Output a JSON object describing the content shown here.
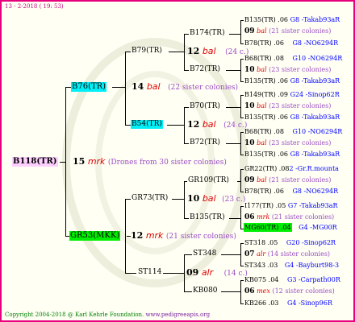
{
  "header": {
    "date_line": "13 - 2-2018 ( 19: 53)"
  },
  "footer": {
    "copyright": "Copyright 2004-2018 @ Karl Kehrle Foundation.",
    "url": "www.pedigreeapis.org"
  },
  "colors": {
    "border": "#e6007e",
    "background": "#fffff4",
    "root_highlight": "#ffd0ff",
    "cyan_highlight": "#00f0f8",
    "green_highlight": "#00ee00",
    "red": "#e00000",
    "purple": "#9a4cc4",
    "blue": "#0000ff"
  },
  "root": {
    "name": "B118(TR)",
    "num": "15",
    "race": "mrk",
    "note": "(Drones from 30 sister colonies)"
  },
  "g1": {
    "upper": {
      "name": "B76(TR)",
      "num": "14",
      "race": "bal",
      "note": "(22 sister colonies)"
    },
    "lower": {
      "name": "GR53(MKK)",
      "num": "12",
      "race": "mrk",
      "note": "(21 sister colonies)"
    }
  },
  "g2": {
    "uu": {
      "name": "B79(TR)"
    },
    "ul": {
      "name": "B54(TR)",
      "num": "12",
      "race": "bal",
      "note": "(24 c.)"
    },
    "lu": {
      "name": "GR73(TR)",
      "num": "10",
      "race": "bal",
      "note": "(23 c.)"
    },
    "ll": {
      "name": "ST114",
      "num": "09",
      "race": "alr",
      "note": "(14 c.)"
    }
  },
  "g3": {
    "b174": {
      "name": "B174(TR)"
    },
    "b79c": {
      "num": "12",
      "race": "bal",
      "note": "(24 c.)"
    },
    "b72a": {
      "name": "B72(TR)"
    },
    "b70": {
      "name": "B70(TR)"
    },
    "b72b": {
      "name": "B72(TR)"
    },
    "gr109": {
      "name": "GR109(TR)"
    },
    "b135": {
      "name": "B135(TR)"
    },
    "st348": {
      "name": "ST348"
    },
    "kb080": {
      "name": "KB080"
    }
  },
  "leaves": [
    {
      "a": "B135(TR) .06",
      "b": "G8 -Takab93aR"
    },
    {
      "num": "09",
      "race": "bal",
      "note": "(21 sister colonies)"
    },
    {
      "a": "B78(TR) .06",
      "b": "G8 -NO6294R"
    },
    {
      "a": "B68(TR) .08",
      "b": "G10 -NO6294R"
    },
    {
      "num": "10",
      "race": "bal",
      "note": "(23 sister colonies)"
    },
    {
      "a": "B135(TR) .06",
      "b": "G8 -Takab93aR"
    },
    {
      "a": "B149(TR) .09",
      "b": "G24 -Sinop62R"
    },
    {
      "num": "10",
      "race": "bal",
      "note": "(23 sister colonies)"
    },
    {
      "a": "B135(TR) .06",
      "b": "G8 -Takab93aR"
    },
    {
      "a": "B68(TR) .08",
      "b": "G10 -NO6294R"
    },
    {
      "num": "10",
      "race": "bal",
      "note": "(23 sister colonies)"
    },
    {
      "a": "B135(TR) .06",
      "b": "G8 -Takab93aR"
    },
    {
      "a": "GR22(TR) .08",
      "b": "2 -Gr.R.mounta"
    },
    {
      "num": "09",
      "race": "bal",
      "note": "(21 sister colonies)"
    },
    {
      "a": "B78(TR) .06",
      "b": "G8 -NO6294R"
    },
    {
      "a": "I177(TR) .05",
      "b": "G7 -Takab93aR"
    },
    {
      "num": "06",
      "race": "mrk",
      "note": "(21 sister colonies)"
    },
    {
      "a": "MG60(TR) .04",
      "b": "G4 -MG00R"
    },
    {
      "a": "ST318 .05",
      "b": "G20 -Sinop62R"
    },
    {
      "num": "07",
      "race": "alr",
      "note": "(14 sister colonies)"
    },
    {
      "a": "ST343 .03",
      "b": "G4 -Bayburt98-3"
    },
    {
      "a": "KB075 .04",
      "b": "G3 -Carpath00R"
    },
    {
      "num": "06",
      "race": "mex",
      "note": "(12 sister colonies)"
    },
    {
      "a": "KB266 .03",
      "b": "G4 -Sinop96R"
    }
  ]
}
